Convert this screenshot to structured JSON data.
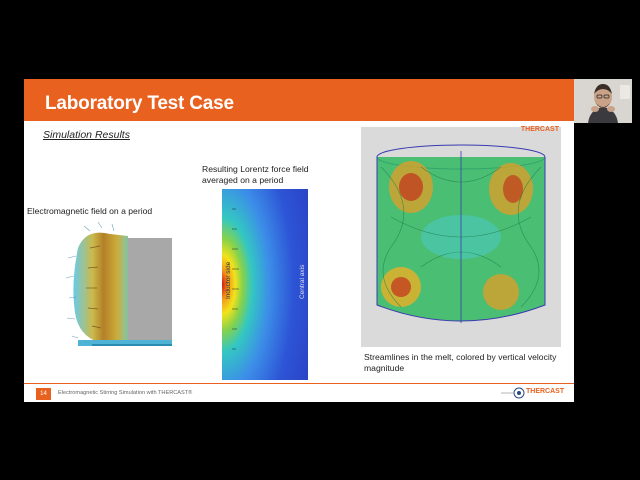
{
  "slide": {
    "title": "Laboratory Test Case",
    "subtitle": "Simulation Results",
    "captions": {
      "em_field": "Electromagnetic field on a period",
      "lorentz": "Resulting Lorentz force field averaged on a period",
      "streamlines": "Streamlines in the melt, colored by vertical velocity magnitude"
    },
    "figure_labels": {
      "inductor_side": "Inductor side",
      "central_axis": "Central axis"
    },
    "logo": "THERCAST",
    "footer": {
      "page_number": "14",
      "text": "Electromagnetic Stirring Simulation with THERCAST®",
      "logo": "THERCAST"
    }
  },
  "colors": {
    "accent": "#e9611f",
    "title_text": "#ffffff"
  }
}
